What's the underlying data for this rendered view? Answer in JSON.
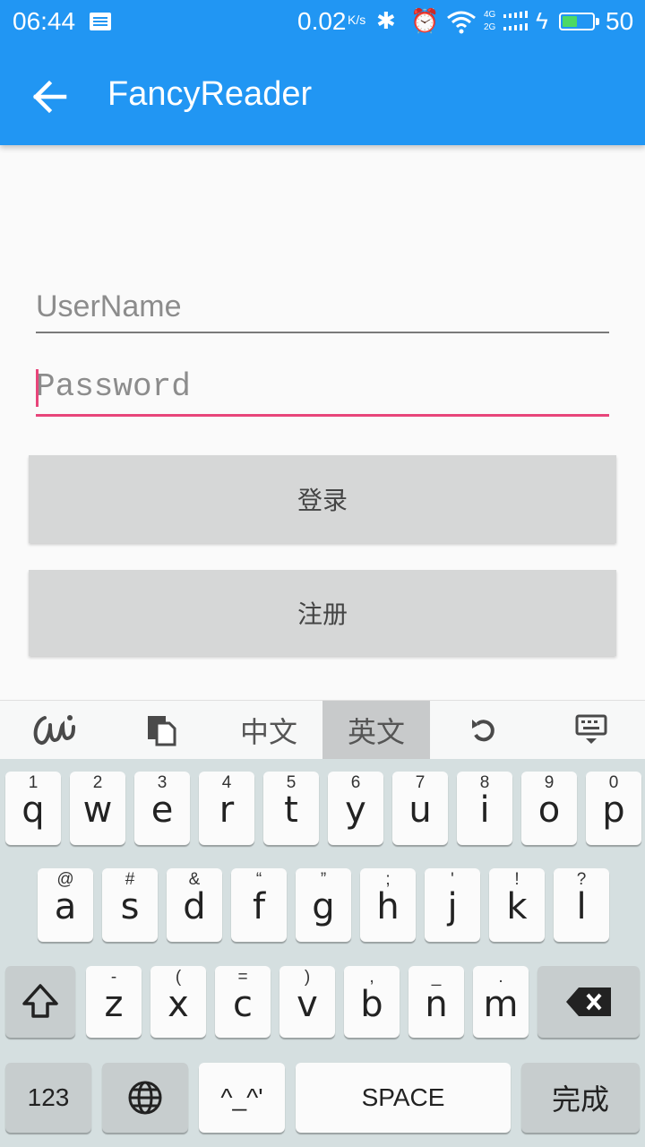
{
  "status_bar": {
    "time": "06:44",
    "net_speed": "0.02",
    "net_speed_unit": "K/s",
    "net_types": [
      "4G",
      "2G"
    ],
    "battery_level": "50",
    "battery_fraction": 0.5,
    "icons": [
      "notification-icon",
      "bluetooth-icon",
      "alarm-icon",
      "wifi-icon",
      "signal-icon",
      "charging-icon",
      "battery-icon"
    ]
  },
  "app_bar": {
    "title": "FancyReader",
    "back_icon": "arrow-back-icon",
    "color": "#2196f3"
  },
  "form": {
    "username_placeholder": "UserName",
    "username_value": "",
    "password_placeholder": "Password",
    "password_value": "",
    "focus_color": "#e8457a",
    "login_label": "登录",
    "register_label": "注册"
  },
  "keyboard": {
    "toolbar": {
      "handwriting_icon": "handwriting-icon",
      "clipboard_icon": "clipboard-icon",
      "chinese_label": "中文",
      "english_label": "英文",
      "active_mode": "英文",
      "undo_icon": "undo-icon",
      "hide_keyboard_icon": "keyboard-hide-icon"
    },
    "row1": [
      {
        "main": "q",
        "sub": "1"
      },
      {
        "main": "w",
        "sub": "2"
      },
      {
        "main": "e",
        "sub": "3"
      },
      {
        "main": "r",
        "sub": "4"
      },
      {
        "main": "t",
        "sub": "5"
      },
      {
        "main": "y",
        "sub": "6"
      },
      {
        "main": "u",
        "sub": "7"
      },
      {
        "main": "i",
        "sub": "8"
      },
      {
        "main": "o",
        "sub": "9"
      },
      {
        "main": "p",
        "sub": "0"
      }
    ],
    "row2": [
      {
        "main": "a",
        "sub": "@"
      },
      {
        "main": "s",
        "sub": "#"
      },
      {
        "main": "d",
        "sub": "&"
      },
      {
        "main": "f",
        "sub": "“"
      },
      {
        "main": "g",
        "sub": "”"
      },
      {
        "main": "h",
        "sub": ";"
      },
      {
        "main": "j",
        "sub": "'"
      },
      {
        "main": "k",
        "sub": "!"
      },
      {
        "main": "l",
        "sub": "?"
      }
    ],
    "row3": [
      {
        "main": "z",
        "sub": "-"
      },
      {
        "main": "x",
        "sub": "("
      },
      {
        "main": "c",
        "sub": "="
      },
      {
        "main": "v",
        "sub": ")"
      },
      {
        "main": "b",
        "sub": ","
      },
      {
        "main": "n",
        "sub": "_"
      },
      {
        "main": "m",
        "sub": "."
      }
    ],
    "shift_icon": "shift-icon",
    "backspace_icon": "backspace-icon",
    "numbers_label": "123",
    "globe_icon": "globe-icon",
    "emoticon_label": "^_^'",
    "space_label": "SPACE",
    "done_label": "完成"
  }
}
